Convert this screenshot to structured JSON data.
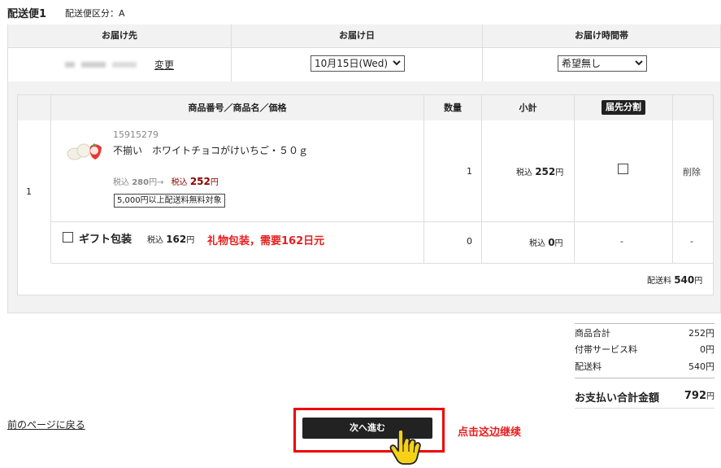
{
  "shipment": {
    "title": "配送便1",
    "subtitle": "配送便区分：A"
  },
  "delivery_headers": {
    "dest": "お届け先",
    "date": "お届け日",
    "time": "お届け時間帯"
  },
  "delivery": {
    "change_link": "変更",
    "date_value": "10月15日(Wed)",
    "time_value": "希望無し"
  },
  "items_headers": {
    "product": "商品番号／商品名／価格",
    "qty": "数量",
    "subtotal": "小計",
    "split_badge": "届先分割"
  },
  "row_index": "1",
  "item": {
    "code": "15915279",
    "name": "不揃い　ホワイトチョコがけいちご・５０ｇ",
    "orig_prefix": "税込",
    "orig_price": "280",
    "orig_suffix": "円→",
    "tax_prefix": "税込",
    "price": "252",
    "yen": "円",
    "badge": "5,000円以上配送料無料対象",
    "qty": "1",
    "subtotal_prefix": "税込",
    "subtotal": "252",
    "subtotal_yen": "円",
    "delete": "削除"
  },
  "gift": {
    "label": "ギフト包装",
    "price_prefix": "税込",
    "price": "162",
    "price_yen": "円",
    "note": "礼物包装，需要162日元",
    "qty": "0",
    "subtotal_prefix": "税込",
    "subtotal": "0",
    "subtotal_yen": "円",
    "split": "-",
    "delete": "-"
  },
  "shipping_fee": {
    "label": "配送料",
    "value": "540",
    "yen": "円"
  },
  "summary": {
    "items_total_label": "商品合計",
    "items_total": "252円",
    "service_label": "付帯サービス料",
    "service": "0円",
    "shipping_label": "配送料",
    "shipping": "540円",
    "grand_label": "お支払い合計金額",
    "grand_value": "792",
    "grand_yen": "円"
  },
  "back_link": "前のページに戻る",
  "next_button": "次へ進む",
  "annotation": "点击这边继续",
  "colors": {
    "accent_red": "#e61e1e",
    "button_bg": "#222222",
    "price_red": "#8b0000"
  }
}
